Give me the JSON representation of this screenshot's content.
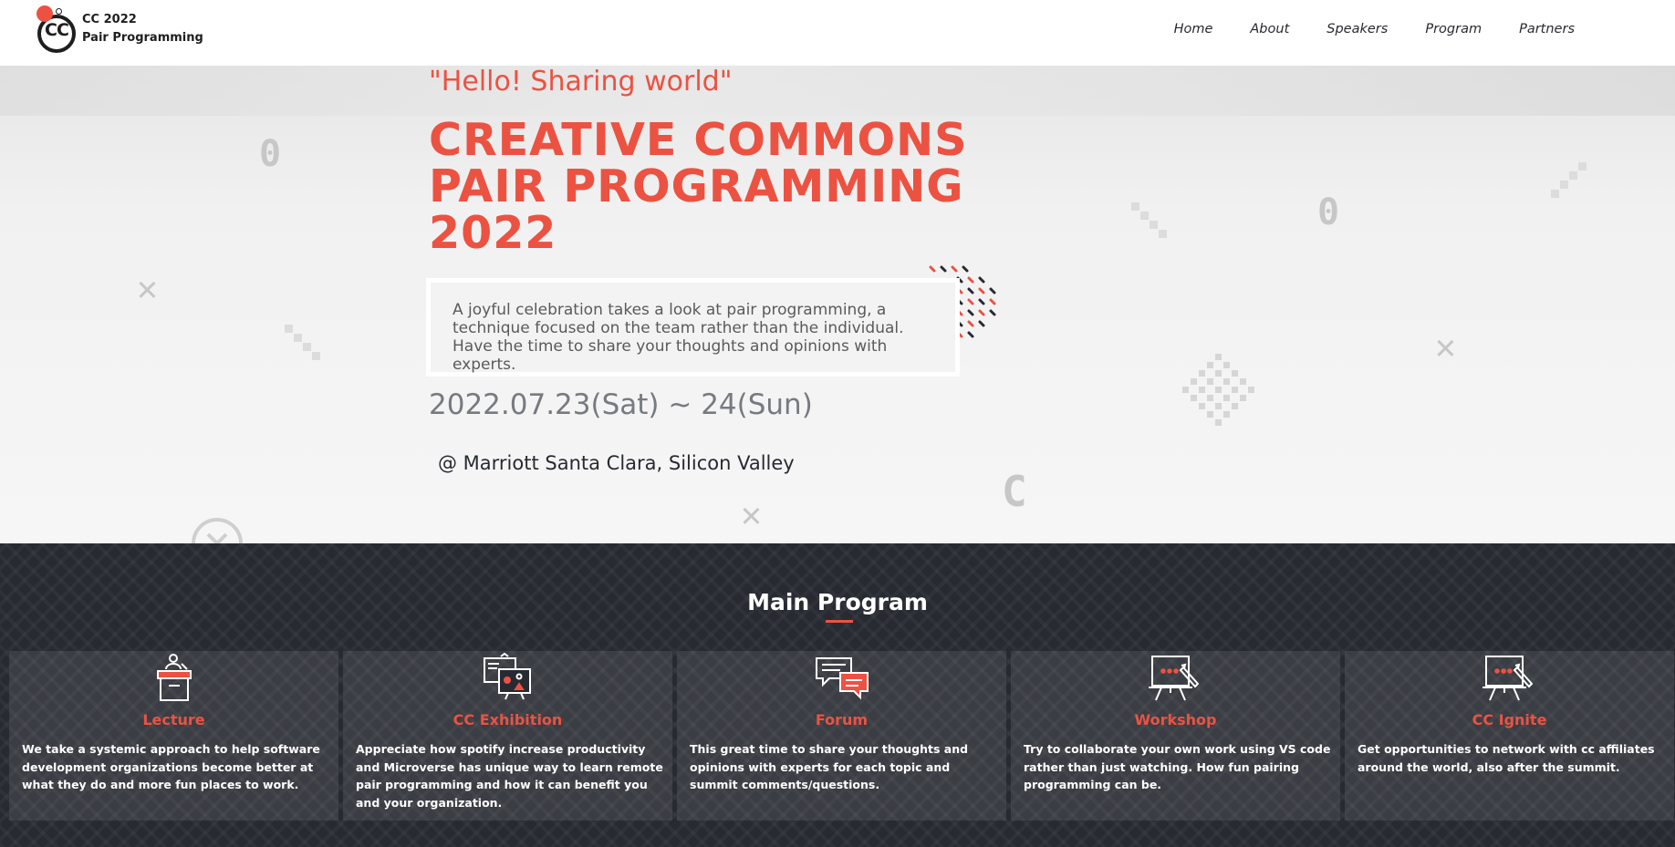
{
  "logo": {
    "mark": "CC",
    "line1": "CC 2022",
    "line2": "Pair Programming"
  },
  "nav": {
    "items": [
      {
        "label": "Home"
      },
      {
        "label": "About"
      },
      {
        "label": "Speakers"
      },
      {
        "label": "Program"
      },
      {
        "label": "Partners"
      }
    ]
  },
  "hero": {
    "tagline": "\"Hello! Sharing world\"",
    "title": "CREATIVE COMMONS PAIR PROGRAMMING 2022",
    "description": "A joyful celebration takes a look at pair programming, a technique focused on the team rather than the individual. Have the time to share your thoughts and opinions with experts.",
    "date": "2022.07.23(Sat) ~ 24(Sun)",
    "venue": "@ Marriott Santa Clara, Silicon Valley"
  },
  "program": {
    "title": "Main Program",
    "cards": [
      {
        "icon": "lecture-podium-icon",
        "title": "Lecture",
        "text": "We take a systemic approach to help software development organizations become better at what they do and more fun places to work."
      },
      {
        "icon": "exhibition-icon",
        "title": "CC Exhibition",
        "text": "Appreciate how spotify increase productivity and Microverse has unique way to learn remote pair programming and how it can benefit you and your organization."
      },
      {
        "icon": "forum-chat-icon",
        "title": "Forum",
        "text": "This great time to share your thoughts and opinions with experts for each topic and summit comments/questions."
      },
      {
        "icon": "workshop-easel-icon",
        "title": "Workshop",
        "text": "Try to collaborate your own work using VS code rather than just watching. How fun pairing programming can be."
      },
      {
        "icon": "ignite-easel-icon",
        "title": "CC Ignite",
        "text": "Get opportunities to network with cc affiliates around the world, also after the summit."
      }
    ]
  },
  "colors": {
    "accent": "#ec5242",
    "dark": "#272a31",
    "text_gray": "#5a5a5a"
  }
}
